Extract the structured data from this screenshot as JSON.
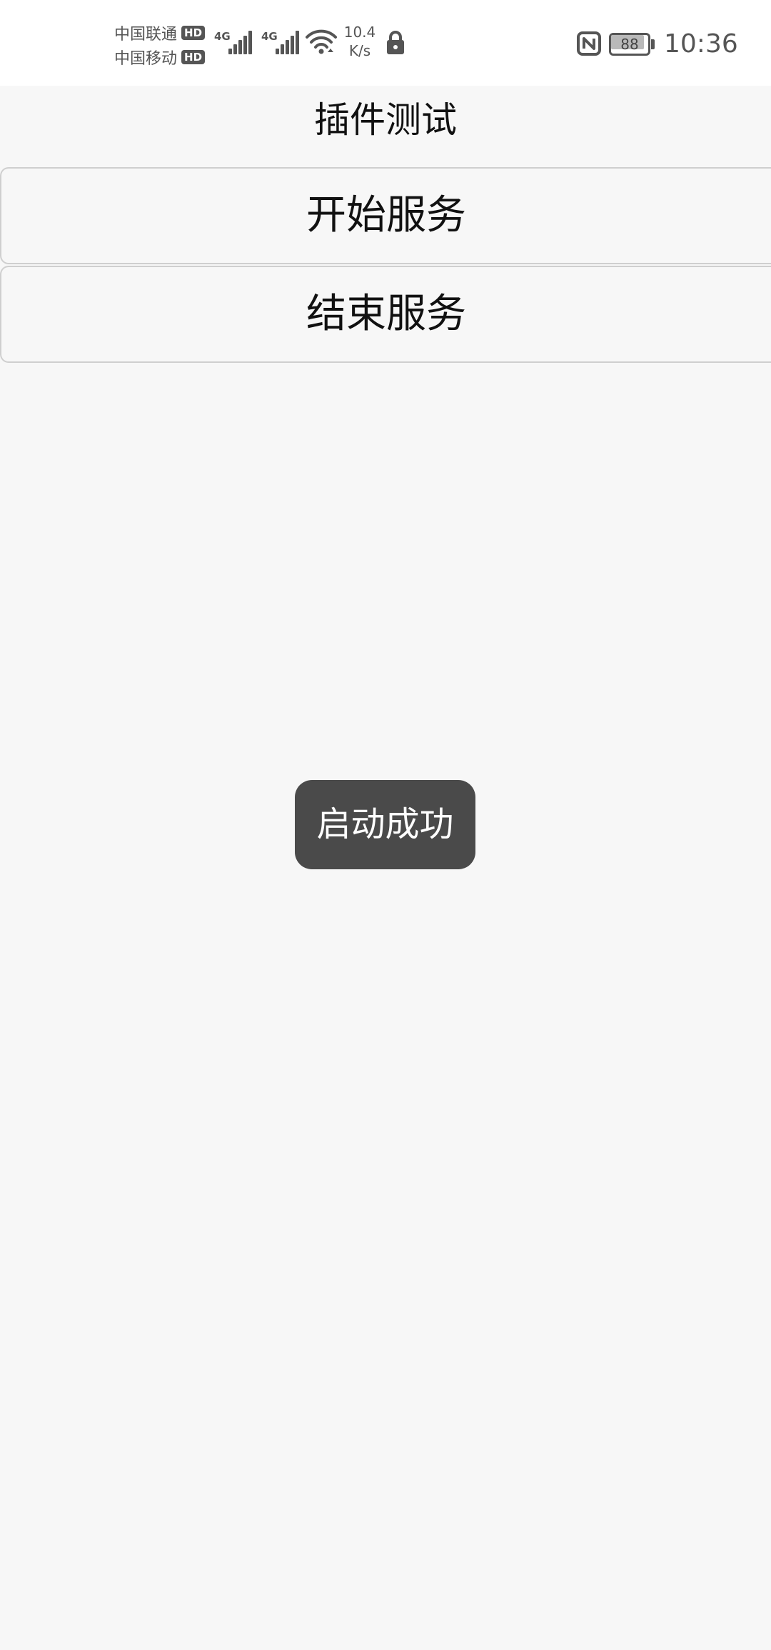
{
  "status_bar": {
    "carrier_1": "中国联通",
    "carrier_2": "中国移动",
    "hd_badge": "HD",
    "network_type_1": "4G",
    "network_type_2": "4G",
    "speed_value": "10.4",
    "speed_unit": "K/s",
    "battery_level": "88",
    "time": "10:36",
    "icons": [
      "signal-icon",
      "wifi-icon",
      "lock-icon",
      "nfc-icon",
      "battery-icon"
    ]
  },
  "app": {
    "title": "插件测试"
  },
  "buttons": {
    "start_service": "开始服务",
    "stop_service": "结束服务"
  },
  "toast": {
    "message": "启动成功"
  }
}
